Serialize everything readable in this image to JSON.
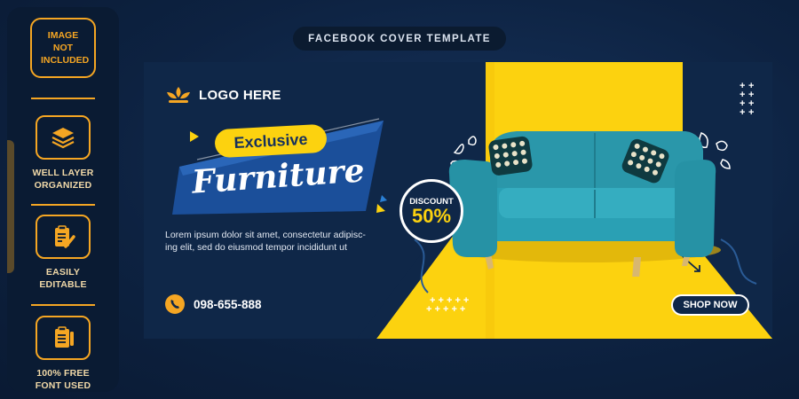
{
  "side_panel": {
    "image_not_included": "IMAGE NOT INCLUDED",
    "features": [
      {
        "label_line1": "WELL LAYER",
        "label_line2": "ORGANIZED",
        "icon": "layers-icon"
      },
      {
        "label_line1": "EASILY",
        "label_line2": "EDITABLE",
        "icon": "edit-document-icon"
      },
      {
        "label_line1": "100% FREE",
        "label_line2": "FONT USED",
        "icon": "font-document-icon"
      }
    ]
  },
  "header": {
    "title": "FACEBOOK COVER TEMPLATE"
  },
  "banner": {
    "logo_text": "LOGO HERE",
    "badge": "Exclusive",
    "title": "Furniture",
    "body_line1": "Lorem ipsum dolor sit amet, consectetur adipisc-",
    "body_line2": "ing elit, sed do eiusmod tempor incididunt ut",
    "phone": "098-655-888",
    "discount_label": "DISCOUNT",
    "discount_value": "50%",
    "cta": "SHOP NOW"
  },
  "colors": {
    "accent": "#f5a623",
    "yellow": "#fcd20f",
    "navy": "#0f2748",
    "sofa": "#2a97aa"
  }
}
